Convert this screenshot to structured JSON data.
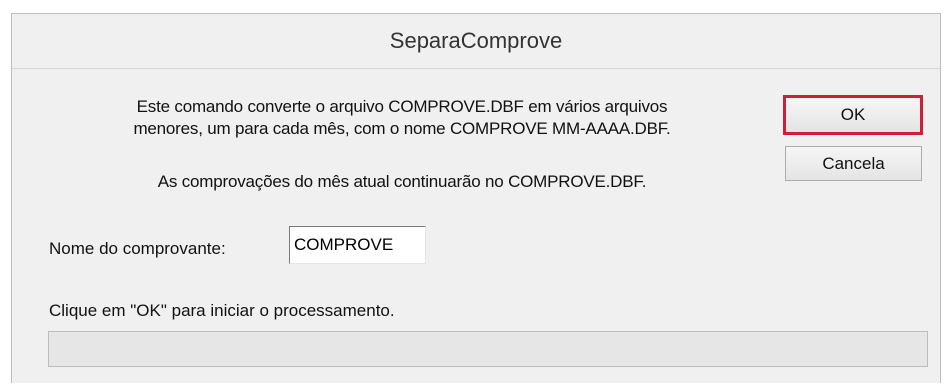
{
  "window": {
    "title": "SeparaComprove"
  },
  "dialog": {
    "description_line1": "Este comando converte o arquivo COMPROVE.DBF em vários arquivos",
    "description_line2": "menores, um para cada mês, com o nome COMPROVE MM-AAAA.DBF.",
    "note": "As comprovações do mês atual continuarão no COMPROVE.DBF.",
    "field_label": "Nome do comprovante:",
    "field_value": "COMPROVE",
    "hint": "Clique em \"OK\" para iniciar o processamento.",
    "progress_fraction": 0
  },
  "buttons": {
    "ok_label": "OK",
    "cancel_label": "Cancela"
  },
  "colors": {
    "window_bg": "#f0f0f0",
    "ok_highlight": "#cc1f3a",
    "progress_track": "#e6e6e6"
  }
}
